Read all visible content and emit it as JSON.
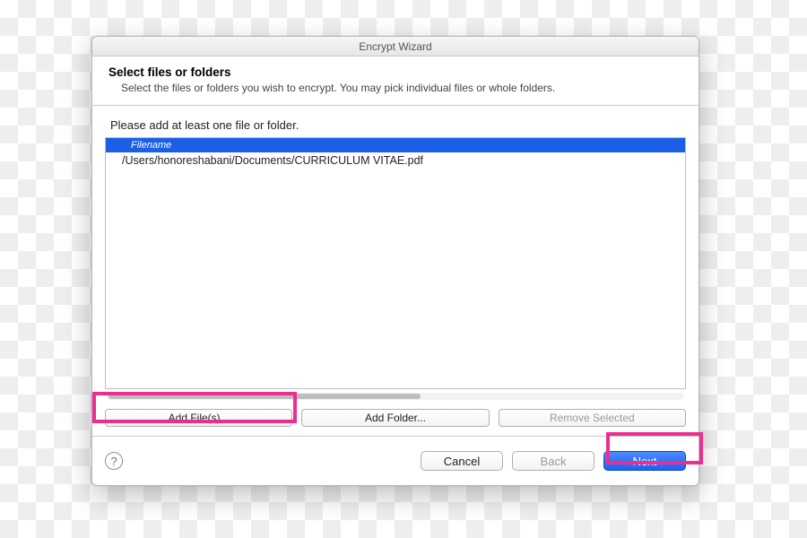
{
  "window": {
    "title": "Encrypt Wizard"
  },
  "header": {
    "title": "Select files or folders",
    "subtitle": "Select the files or folders you wish to encrypt. You may pick individual files or whole folders."
  },
  "main": {
    "instruction": "Please add at least one file or folder.",
    "columnHeader": "Filename",
    "rows": [
      "/Users/honoreshabani/Documents/CURRICULUM  VITAE.pdf"
    ],
    "buttons": {
      "addFiles": "Add File(s)...",
      "addFolder": "Add Folder...",
      "removeSelected": "Remove Selected"
    }
  },
  "footer": {
    "help": "?",
    "cancel": "Cancel",
    "back": "Back",
    "next": "Next"
  }
}
